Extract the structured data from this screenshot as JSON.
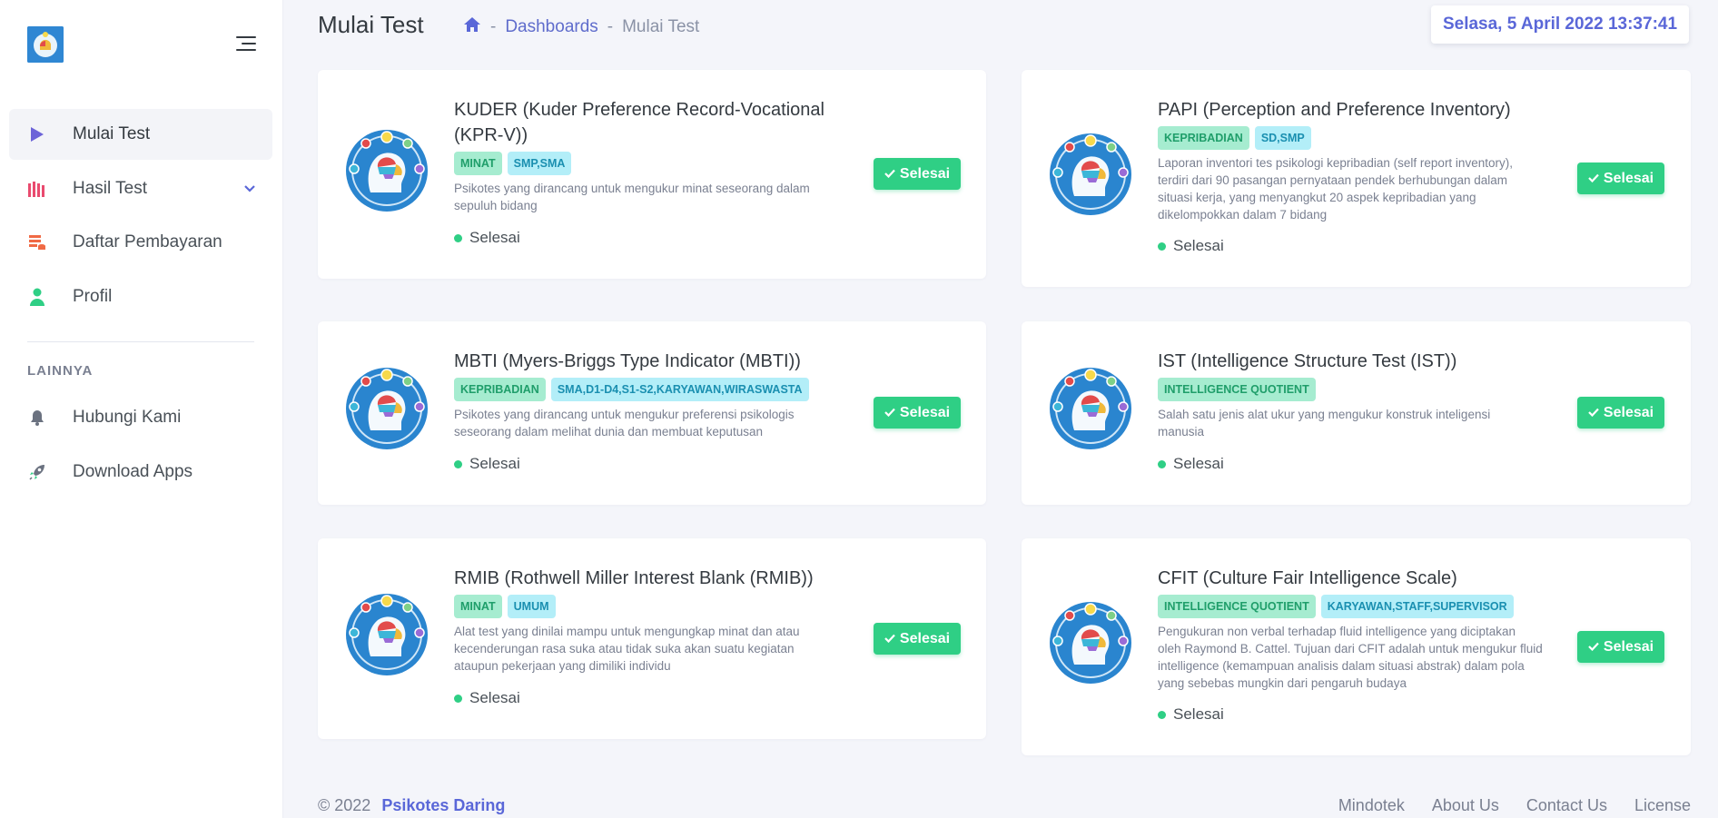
{
  "sidebar": {
    "items": [
      {
        "label": "Mulai Test",
        "icon": "play-icon"
      },
      {
        "label": "Hasil Test",
        "icon": "bar-chart-icon"
      },
      {
        "label": "Daftar Pembayaran",
        "icon": "database-icon"
      },
      {
        "label": "Profil",
        "icon": "user-icon"
      }
    ],
    "section": "LAINNYA",
    "extra": [
      {
        "label": "Hubungi Kami",
        "icon": "bell-icon"
      },
      {
        "label": "Download Apps",
        "icon": "rocket-icon"
      }
    ]
  },
  "header": {
    "title": "Mulai Test",
    "breadcrumb": {
      "link": "Dashboards",
      "current": "Mulai Test"
    },
    "datetime": "Selasa, 5 April 2022 13:37:41"
  },
  "tests": [
    {
      "title_line1": "KUDER (Kuder Preference Record-Vocational",
      "title_line2": "(KPR-V))",
      "badges": [
        "MINAT",
        "SMP,SMA"
      ],
      "desc": [
        "Psikotes yang dirancang untuk mengukur minat seseorang dalam",
        "sepuluh bidang"
      ],
      "status": "Selesai",
      "button": "Selesai"
    },
    {
      "title_line1": "PAPI (Perception and Preference Inventory)",
      "badges": [
        "KEPRIBADIAN",
        "SD,SMP"
      ],
      "desc": [
        "Laporan inventori tes psikologi kepribadian (self report inventory),",
        "terdiri dari 90 pasangan pernyataan pendek berhubungan dalam",
        "situasi kerja, yang menyangkut 20 aspek kepribadian yang",
        "dikelompokkan dalam 7 bidang"
      ],
      "status": "Selesai",
      "button": "Selesai"
    },
    {
      "title_line1": "MBTI (Myers-Briggs Type Indicator (MBTI))",
      "badges": [
        "KEPRIBADIAN",
        "SMA,D1-D4,S1-S2,KARYAWAN,WIRASWASTA"
      ],
      "desc": [
        "Psikotes yang dirancang untuk mengukur preferensi psikologis",
        "seseorang dalam melihat dunia dan membuat keputusan"
      ],
      "status": "Selesai",
      "button": "Selesai"
    },
    {
      "title_line1": "IST (Intelligence Structure Test (IST))",
      "badges": [
        "INTELLIGENCE QUOTIENT"
      ],
      "desc": [
        "Salah satu jenis alat ukur yang mengukur konstruk inteligensi",
        "manusia"
      ],
      "status": "Selesai",
      "button": "Selesai"
    },
    {
      "title_line1": "RMIB (Rothwell Miller Interest Blank (RMIB))",
      "badges": [
        "MINAT",
        "UMUM"
      ],
      "desc": [
        "Alat test yang dinilai mampu untuk mengungkap minat dan atau",
        "kecenderungan rasa suka atau tidak suka akan suatu kegiatan",
        "ataupun pekerjaan yang dimiliki individu"
      ],
      "status": "Selesai",
      "button": "Selesai"
    },
    {
      "title_line1": "CFIT (Culture Fair Intelligence Scale)",
      "badges": [
        "INTELLIGENCE QUOTIENT",
        "KARYAWAN,STAFF,SUPERVISOR"
      ],
      "desc": [
        "Pengukuran non verbal terhadap fluid intelligence yang diciptakan",
        "oleh Raymond B. Cattel. Tujuan dari CFIT adalah untuk mengukur fluid",
        "intelligence (kemampuan analisis dalam situasi abstrak) dalam pola",
        "yang sebebas mungkin dari pengaruh budaya"
      ],
      "status": "Selesai",
      "button": "Selesai"
    }
  ],
  "footer": {
    "copyright": "© 2022",
    "brand": "Psikotes Daring",
    "links": [
      "Mindotek",
      "About Us",
      "Contact Us",
      "License"
    ]
  },
  "colors": {
    "accent": "#5a67d8",
    "success": "#2fcf85",
    "badge_green": "#a6ecd0",
    "badge_cyan": "#b3eef8"
  }
}
